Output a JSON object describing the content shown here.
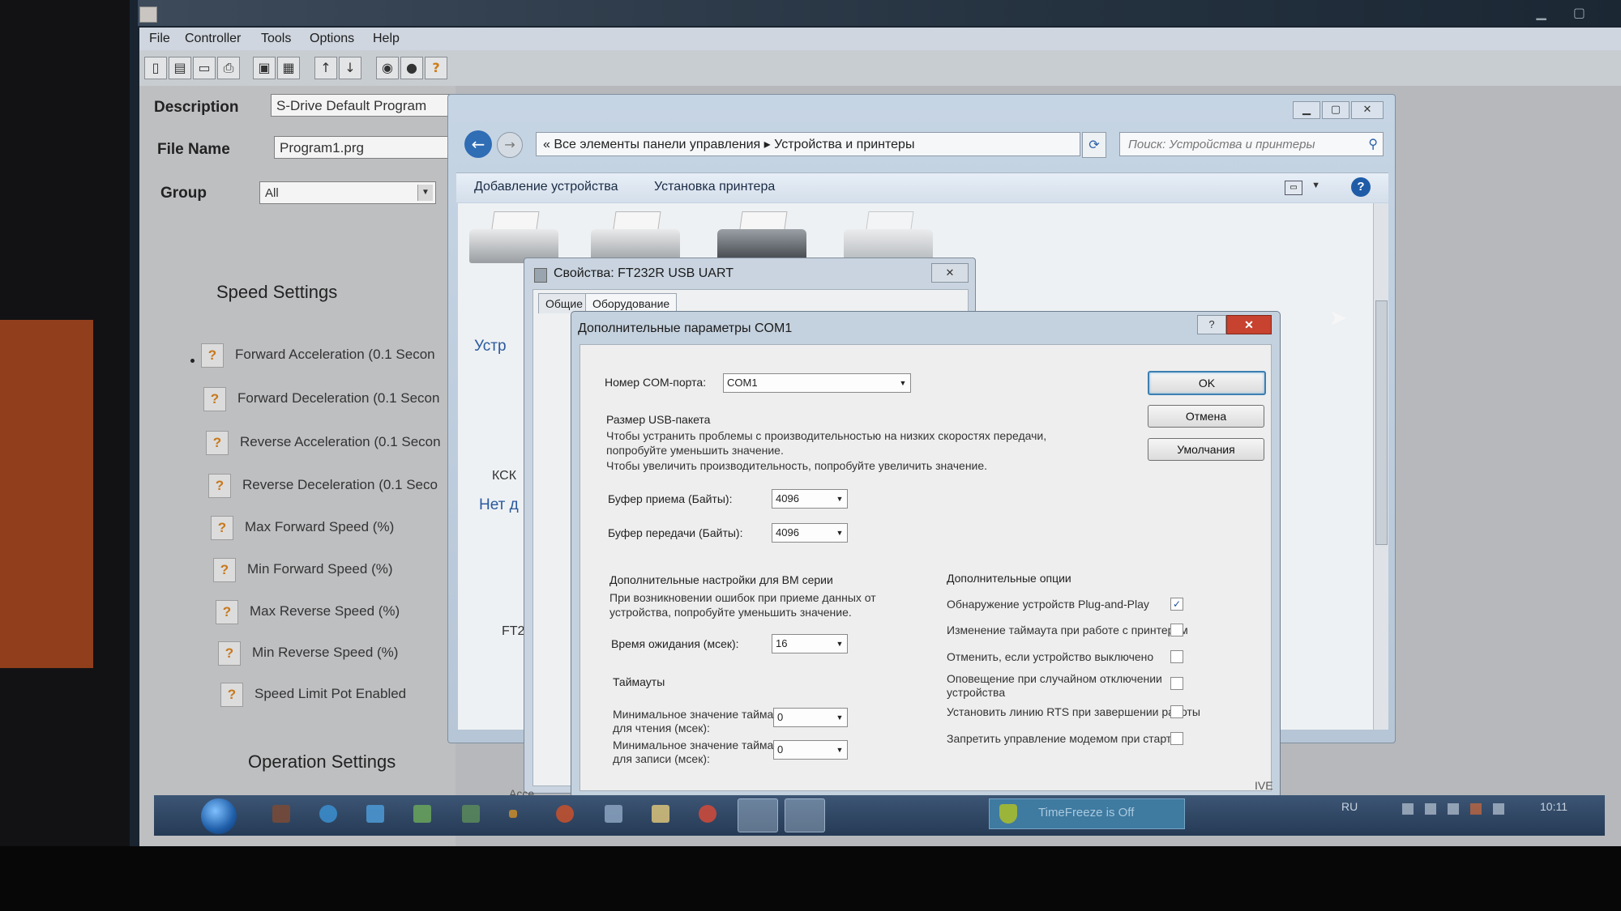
{
  "app": {
    "menu": [
      "File",
      "Controller",
      "Tools",
      "Options",
      "Help"
    ],
    "form": {
      "description_label": "Description",
      "description_value": "S-Drive  Default Program",
      "filename_label": "File Name",
      "filename_value": "Program1.prg",
      "group_label": "Group",
      "group_value": "All"
    },
    "speed_settings_title": "Speed Settings",
    "speed_settings": [
      "Forward Acceleration (0.1 Secon",
      "Forward Deceleration (0.1 Secon",
      "Reverse Acceleration (0.1 Secon",
      "Reverse Deceleration (0.1 Seco",
      "Max Forward Speed (%)",
      "Min Forward Speed (%)",
      "Max Reverse Speed (%)",
      "Min Reverse Speed (%)",
      "Speed Limit Pot Enabled"
    ],
    "help_mark": "?",
    "operation_settings_title": "Operation Settings",
    "toolbar_icons": [
      "new-icon",
      "open-icon",
      "print-setup-icon",
      "print-icon",
      "save-icon",
      "save-as-icon",
      "upload-icon",
      "download-icon",
      "controller-icon",
      "lock-icon",
      "help-icon"
    ]
  },
  "explorer": {
    "address_prefix": "«",
    "address_part1": "Все элементы панели управления",
    "address_sep": "▸",
    "address_part2": "Устройства и принтеры",
    "search_placeholder": "Поиск: Устройства и принтеры",
    "cmd_add_device": "Добавление устройства",
    "cmd_add_printer": "Установка принтера",
    "side_group1": "Устр",
    "side_device1": "КСК",
    "side_group2": "Нет д",
    "side_device2": "FT2",
    "bottom_fragment": "Acce",
    "right_fragment": "IVE"
  },
  "props": {
    "title": "Свойства: FT232R USB UART",
    "tab1": "Общие",
    "tab2": "Оборудование"
  },
  "com_dialog": {
    "title": "Дополнительные параметры COM1",
    "port_label": "Номер COM-порта:",
    "port_value": "COM1",
    "usb_size_title": "Размер USB-пакета",
    "usb_hint1": "Чтобы устранить проблемы с производительностью на низких скоростях передачи,",
    "usb_hint2": "попробуйте уменьшить значение.",
    "usb_hint3": "Чтобы увеличить производительность, попробуйте увеличить значение.",
    "rx_label": "Буфер приема (Байты):",
    "rx_value": "4096",
    "tx_label": "Буфер передачи (Байты):",
    "tx_value": "4096",
    "bm_title": "Дополнительные настройки для BM серии",
    "bm_hint1": "При возникновении ошибок при приеме данных от",
    "bm_hint2": "устройства, попробуйте уменьшить значение.",
    "latency_label": "Время ожидания (мсек):",
    "latency_value": "16",
    "timeouts_title": "Таймауты",
    "read_timeout_label1": "Минимальное значение таймаута",
    "read_timeout_label2": "для чтения (мсек):",
    "read_timeout_value": "0",
    "write_timeout_label1": "Минимальное значение таймаута",
    "write_timeout_label2": "для записи (мсек):",
    "write_timeout_value": "0",
    "options_title": "Дополнительные опции",
    "options": [
      {
        "label": "Обнаружение устройств Plug-and-Play",
        "checked": true
      },
      {
        "label": "Изменение таймаута при работе с принтером",
        "checked": false
      },
      {
        "label": "Отменить, если устройство выключено",
        "checked": false
      },
      {
        "label": "Оповещение при случайном отключении",
        "checked": false
      },
      {
        "label": "Установить линию RTS при завершении работы",
        "checked": false
      },
      {
        "label": "Запретить управление модемом при старте",
        "checked": false
      }
    ],
    "option4_line2": "устройства",
    "btn_ok": "OK",
    "btn_cancel": "Отмена",
    "btn_defaults": "Умолчания",
    "check_mark": "✓"
  },
  "taskbar": {
    "timefreeze": "TimeFreeze is Off",
    "lang": "RU",
    "time": "10:11"
  }
}
